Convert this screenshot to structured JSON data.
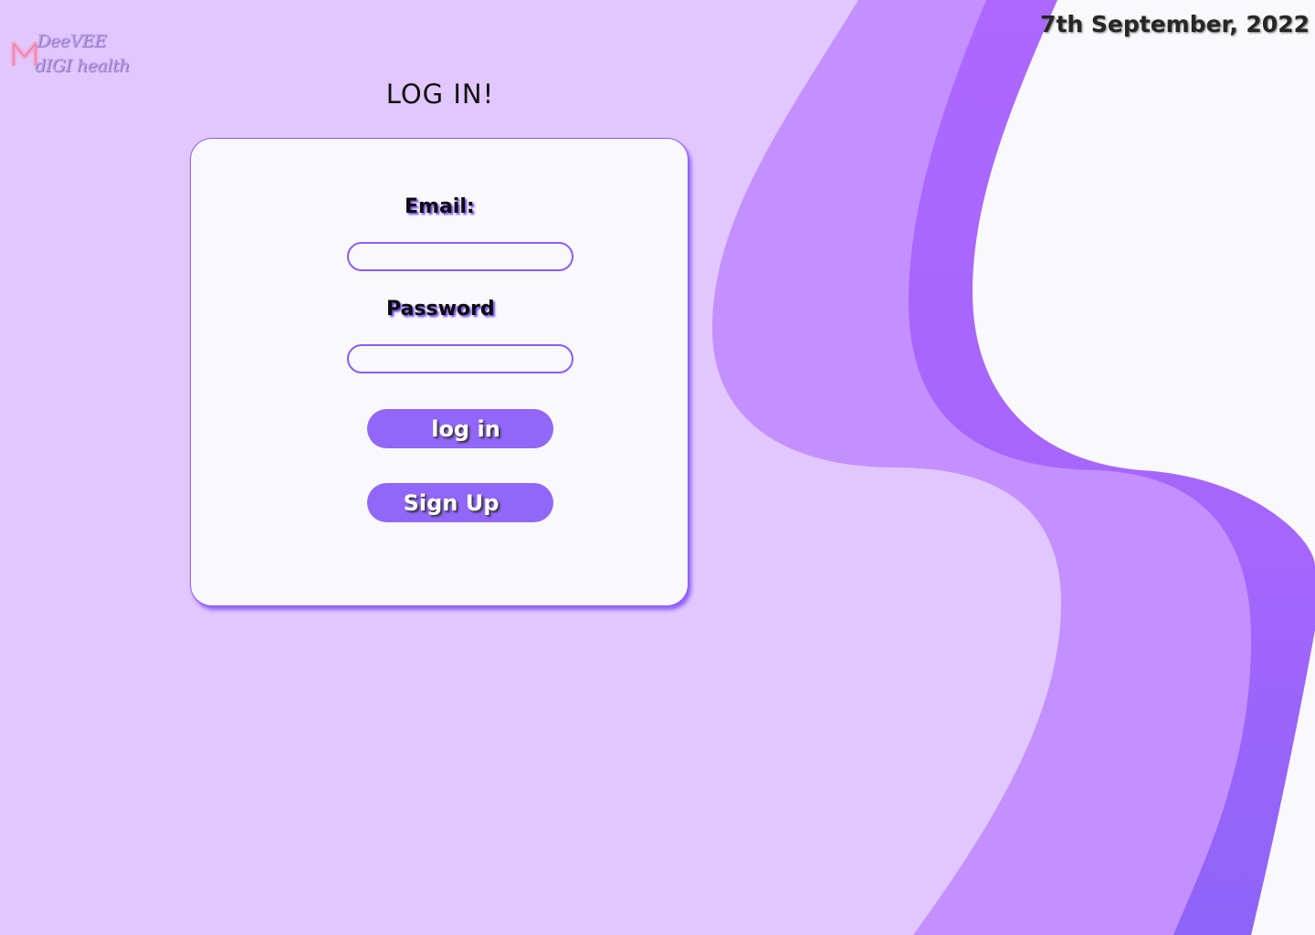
{
  "branding": {
    "logo_line1": "DeeVEE",
    "logo_line2": "dIGI health",
    "logo_icon": "pink-m-logo-icon"
  },
  "header": {
    "date": "7th September, 2022"
  },
  "login": {
    "title": "LOG IN!",
    "email_label": "Email:",
    "email_value": "",
    "email_placeholder": "",
    "password_label": "Password",
    "password_value": "",
    "password_placeholder": "",
    "login_button": "log in",
    "signup_button": "Sign Up"
  },
  "colors": {
    "background": "#e1c7fd",
    "wave_light": "#c48ffe",
    "wave_dark": "#a766fd",
    "card_background": "#f9f8fb",
    "accent": "#8b5cf6",
    "button": "#9166f8"
  }
}
